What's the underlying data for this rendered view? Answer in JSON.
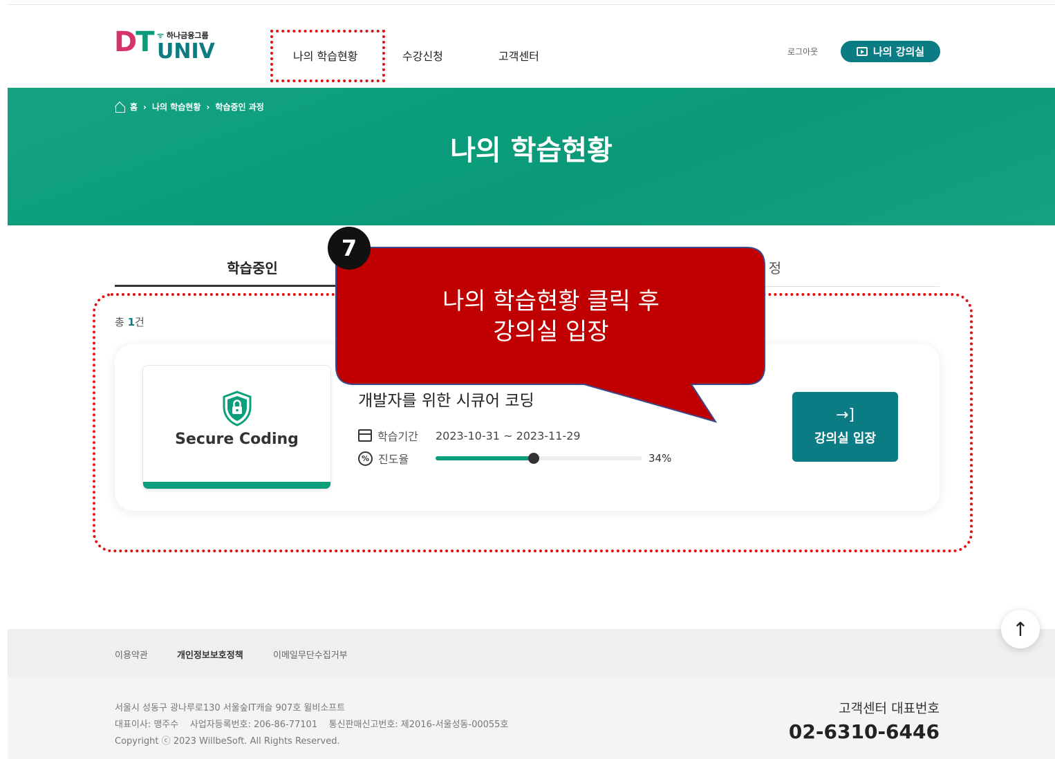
{
  "header": {
    "logo": {
      "mark": "DT",
      "group": "하나금융그룹",
      "univ": "UNIV"
    },
    "nav": [
      "나의 학습현황",
      "수강신청",
      "고객센터"
    ],
    "logout": "로그아웃",
    "my_class_button": "나의 강의실"
  },
  "banner": {
    "breadcrumb": [
      "홈",
      "나의 학습현황",
      "학습중인 과정"
    ],
    "title": "나의 학습현황"
  },
  "tabs": {
    "active": "학습중인",
    "other_fragment": "정"
  },
  "list": {
    "total_prefix": "총",
    "total_count": "1",
    "total_suffix": "건"
  },
  "course": {
    "thumbnail_title": "Secure Coding",
    "title": "개발자를 위한 시큐어 코딩",
    "period_label": "학습기간",
    "period_value": "2023-10-31 ~ 2023-11-29",
    "progress_label": "진도율",
    "progress_icon_text": "%",
    "progress_percent": 34,
    "progress_text": "34%",
    "enter_button": "강의실 입장"
  },
  "callout": {
    "step": "7",
    "line1": "나의 학습현황 클릭 후",
    "line2": "강의실 입장",
    "color": "#c00000"
  },
  "footer": {
    "links": [
      "이용약관",
      "개인정보보호정책",
      "이메일무단수집거부"
    ],
    "address": "서울시 성동구 광나루로130 서울숲IT캐슬 907호 윌비소프트",
    "business": "대표이사: 맹주수    사업자등록번호: 206-86-77101    통신판매신고번호: 제2016-서울성동-00055호",
    "copyright": "Copyright ⓒ 2023 WillbeSoft. All Rights Reserved.",
    "cs_label": "고객센터 대표번호",
    "cs_phone": "02-6310-6446"
  },
  "colors": {
    "brand_green": "#0b9e7c",
    "brand_teal": "#0b7b84",
    "highlight_red": "#e01010"
  }
}
